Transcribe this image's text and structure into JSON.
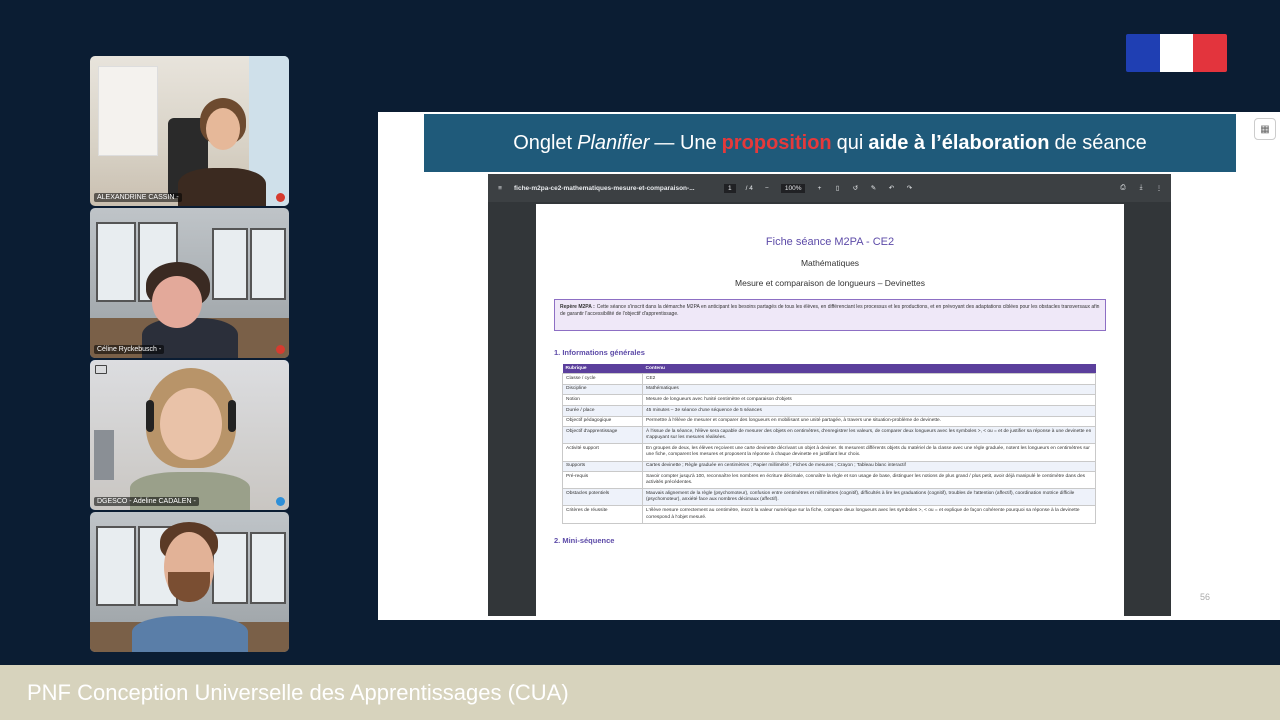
{
  "participants": [
    {
      "name": "ALEXANDRINE CASSIN -",
      "mic": "off"
    },
    {
      "name": "Céline Ryckebusch -",
      "mic": "off"
    },
    {
      "name": "DGESCO - Adeline CADALEN -",
      "mic": "on"
    },
    {
      "name": "",
      "mic": "none"
    }
  ],
  "slide": {
    "title_a": "Onglet",
    "title_b": "Planifier",
    "title_c": "— Une",
    "title_d": "proposition",
    "title_e": "qui",
    "title_f": "aide à l’élaboration",
    "title_g": "de séance",
    "page_number": "56"
  },
  "pdf": {
    "filename": "fiche-m2pa-ce2-mathematiques-mesure-et-comparaison-...",
    "page": "1",
    "page_total": "/ 4",
    "zoom": "100%",
    "doc_title": "Fiche séance M2PA - CE2",
    "subject": "Mathématiques",
    "topic": "Mesure et comparaison de longueurs – Devinettes",
    "repere_label": "Repère M2PA :",
    "repere_text": "Cette séance s'inscrit dans la démarche M2PA en anticipant les besoins partagés de tous les élèves, en différenciant les processus et les productions, et en prévoyant des adaptations ciblées pour les obstacles transversaux afin de garantir l'accessibilité de l'objectif d'apprentissage.",
    "section1": "1. Informations générales",
    "table_headers": [
      "Rubrique",
      "Contenu"
    ],
    "table_rows": [
      [
        "Classe / cycle",
        "CE2"
      ],
      [
        "Discipline",
        "Mathématiques"
      ],
      [
        "Notion",
        "Mesure de longueurs avec l'unité centimètre et comparaison d'objets"
      ],
      [
        "Durée / place",
        "45 minutes – 3e séance d'une séquence de 5 séances"
      ],
      [
        "Objectif pédagogique",
        "Permettre à l'élève de mesurer et comparer des longueurs en mobilisant une unité partagée, à travers une situation-problème de devinette."
      ],
      [
        "Objectif d'apprentissage",
        "À l'issue de la séance, l'élève sera capable de mesurer des objets en centimètres, d'enregistrer les valeurs, de comparer deux longueurs avec les symboles >, < ou = et de justifier sa réponse à une devinette en s'appuyant sur les mesures réalisées."
      ],
      [
        "Activité support",
        "En groupes de deux, les élèves reçoivent une carte devinette décrivant un objet à deviner. Ils mesurent différents objets du matériel de la classe avec une règle graduée, notent les longueurs en centimètres sur une fiche, comparent les mesures et proposent la réponse à chaque devinette en justifiant leur choix."
      ],
      [
        "Supports",
        "Cartes devinette ; Règle graduée en centimètres ; Papier millimétré ; Fiches de mesures ; Crayon ; Tableau blanc interactif"
      ],
      [
        "Pré-requis",
        "Savoir compter jusqu'à 100, reconnaître les nombres en écriture décimale, connaître la règle et son usage de base, distinguer les notions de plus grand / plus petit, avoir déjà manipulé le centimètre dans des activités précédentes."
      ],
      [
        "Obstacles potentiels",
        "Mauvais alignement de la règle (psychomoteur), confusion entre centimètres et millimètres (cognitif), difficultés à lire les graduations (cognitif), troubles de l'attention (affectif), coordination motrice difficile (psychomoteur), anxiété face aux nombres décimaux (affectif)."
      ],
      [
        "Critères de réussite",
        "L'élève mesure correctement au centimètre, inscrit la valeur numérique sur la fiche, compare deux longueurs avec les symboles >, < ou = et explique de façon cohérente pourquoi sa réponse à la devinette correspond à l'objet mesuré."
      ]
    ],
    "section2": "2. Mini-séquence"
  },
  "footer": {
    "text": "PNF Conception Universelle des Apprentissages (CUA)"
  },
  "colors": {
    "background": "#0b1d33",
    "banner": "#1f5a7a",
    "accent_red": "#e5393b",
    "doc_purple": "#5d4ba8",
    "footer": "#d7d3bd"
  }
}
